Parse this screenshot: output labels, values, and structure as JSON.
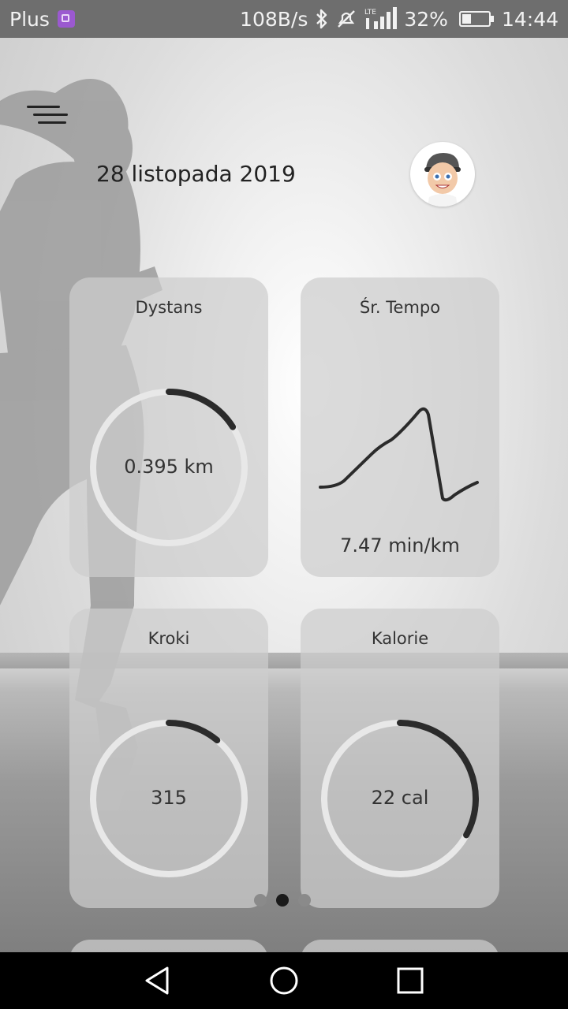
{
  "status_bar": {
    "carrier": "Plus",
    "speed": "108B/s",
    "network": "LTE",
    "battery": "32%",
    "time": "14:44"
  },
  "header": {
    "date": "28 listopada 2019"
  },
  "cards": {
    "distance": {
      "title": "Dystans",
      "value": "0.395 km",
      "progress": 0.16
    },
    "pace": {
      "title": "Śr. Tempo",
      "value": "7.47 min/km"
    },
    "steps": {
      "title": "Kroki",
      "value": "315",
      "progress": 0.11
    },
    "calories": {
      "title": "Kalorie",
      "value": "22 cal",
      "progress": 0.33
    }
  },
  "pager": {
    "pages": 3,
    "active": 1
  },
  "colors": {
    "ring_track": "#e8e8e8",
    "ring_fill": "#2b2b2b",
    "card_bg": "#cdcdcd"
  },
  "icons": [
    "menu-icon",
    "avatar-icon",
    "bluetooth-icon",
    "mute-icon",
    "signal-icon",
    "battery-icon",
    "back-icon",
    "home-icon",
    "recents-icon"
  ]
}
